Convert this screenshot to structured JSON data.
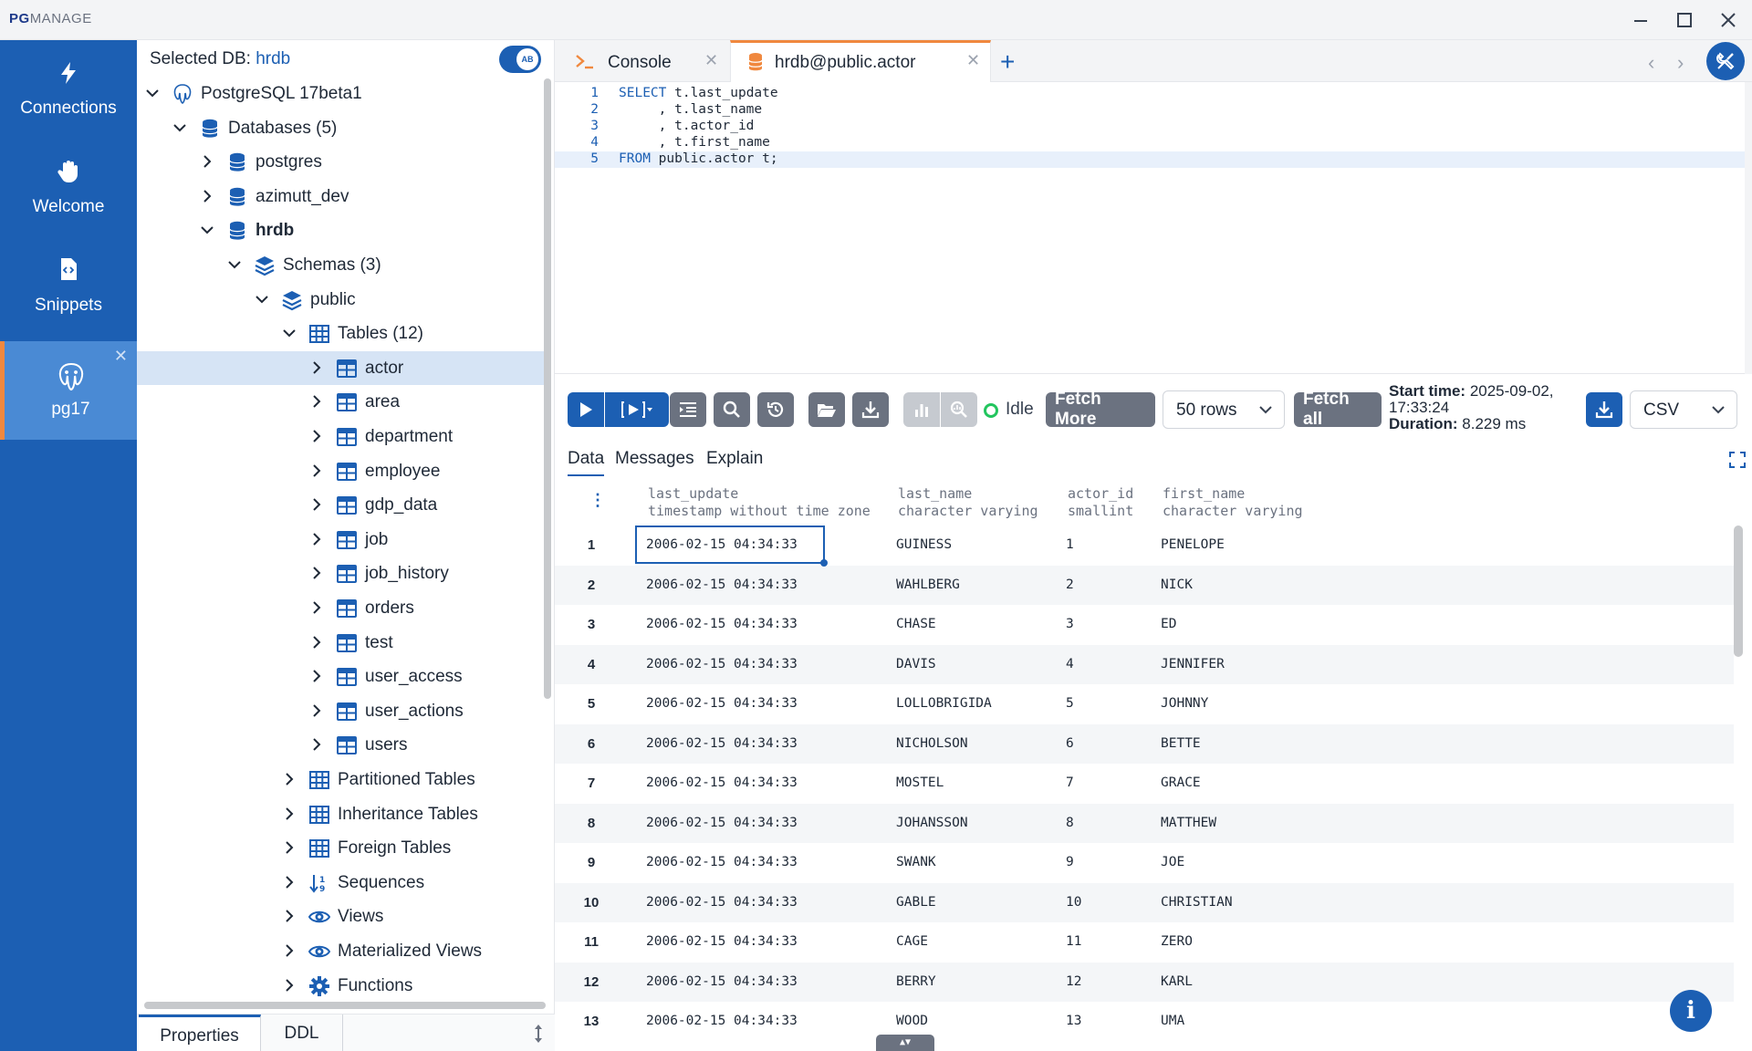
{
  "window": {
    "title_bold": "PG",
    "title_rest": "MANAGE"
  },
  "nav": {
    "items": [
      {
        "label": "Connections",
        "icon": "bolt-icon"
      },
      {
        "label": "Welcome",
        "icon": "hand-icon"
      },
      {
        "label": "Snippets",
        "icon": "code-file-icon"
      },
      {
        "label": "pg17",
        "icon": "postgres-elephant-icon",
        "close": "✕"
      }
    ]
  },
  "tree": {
    "selected_db_label": "Selected DB:",
    "selected_db_value": "hrdb",
    "nodes": [
      {
        "label": "PostgreSQL 17beta1",
        "depth": 0,
        "expanded": true,
        "icon": "elephant"
      },
      {
        "label": "Databases (5)",
        "depth": 1,
        "expanded": true,
        "icon": "database"
      },
      {
        "label": "postgres",
        "depth": 2,
        "expanded": false,
        "icon": "database"
      },
      {
        "label": "azimutt_dev",
        "depth": 2,
        "expanded": false,
        "icon": "database"
      },
      {
        "label": "hrdb",
        "depth": 2,
        "expanded": true,
        "icon": "database",
        "bold": true
      },
      {
        "label": "Schemas (3)",
        "depth": 3,
        "expanded": true,
        "icon": "layers"
      },
      {
        "label": "public",
        "depth": 4,
        "expanded": true,
        "icon": "layers"
      },
      {
        "label": "Tables (12)",
        "depth": 5,
        "expanded": true,
        "icon": "grid"
      },
      {
        "label": "actor",
        "depth": 6,
        "expanded": false,
        "icon": "table",
        "selected": true
      },
      {
        "label": "area",
        "depth": 6,
        "expanded": false,
        "icon": "table"
      },
      {
        "label": "department",
        "depth": 6,
        "expanded": false,
        "icon": "table"
      },
      {
        "label": "employee",
        "depth": 6,
        "expanded": false,
        "icon": "table"
      },
      {
        "label": "gdp_data",
        "depth": 6,
        "expanded": false,
        "icon": "table"
      },
      {
        "label": "job",
        "depth": 6,
        "expanded": false,
        "icon": "table"
      },
      {
        "label": "job_history",
        "depth": 6,
        "expanded": false,
        "icon": "table"
      },
      {
        "label": "orders",
        "depth": 6,
        "expanded": false,
        "icon": "table"
      },
      {
        "label": "test",
        "depth": 6,
        "expanded": false,
        "icon": "table"
      },
      {
        "label": "user_access",
        "depth": 6,
        "expanded": false,
        "icon": "table"
      },
      {
        "label": "user_actions",
        "depth": 6,
        "expanded": false,
        "icon": "table"
      },
      {
        "label": "users",
        "depth": 6,
        "expanded": false,
        "icon": "table"
      },
      {
        "label": "Partitioned Tables",
        "depth": 5,
        "expanded": false,
        "icon": "grid"
      },
      {
        "label": "Inheritance Tables",
        "depth": 5,
        "expanded": false,
        "icon": "grid"
      },
      {
        "label": "Foreign Tables",
        "depth": 5,
        "expanded": false,
        "icon": "grid"
      },
      {
        "label": "Sequences",
        "depth": 5,
        "expanded": false,
        "icon": "sort"
      },
      {
        "label": "Views",
        "depth": 5,
        "expanded": false,
        "icon": "eye"
      },
      {
        "label": "Materialized Views",
        "depth": 5,
        "expanded": false,
        "icon": "eye"
      },
      {
        "label": "Functions",
        "depth": 5,
        "expanded": false,
        "icon": "gear"
      }
    ],
    "bottom_tabs": [
      "Properties",
      "DDL"
    ]
  },
  "tabs": {
    "items": [
      {
        "label": "Console",
        "close": "✕",
        "icon": "terminal-icon"
      },
      {
        "label": "hrdb@public.actor",
        "close": "✕",
        "icon": "database-icon",
        "active": true
      }
    ],
    "add": "+",
    "prev": "‹",
    "next": "›"
  },
  "editor": {
    "lines": [
      {
        "num": "1",
        "kw": "SELECT",
        "code": " t.last_update"
      },
      {
        "num": "2",
        "kw": "",
        "code": "     , t.last_name"
      },
      {
        "num": "3",
        "kw": "",
        "code": "     , t.actor_id"
      },
      {
        "num": "4",
        "kw": "",
        "code": "     , t.first_name"
      },
      {
        "num": "5",
        "kw": "FROM",
        "code": " public.actor t;"
      }
    ]
  },
  "toolbar": {
    "status": "Idle",
    "fetch_more": "Fetch More",
    "rows_option": "50 rows",
    "fetch_all": "Fetch all",
    "start_label": "Start time:",
    "start_value": "2025-09-02, 17:33:24",
    "duration_label": "Duration:",
    "duration_value": "8.229 ms",
    "export_format": "CSV",
    "colors": {
      "accent": "#1c5fb3",
      "idle": "#22c55e",
      "tab_accent": "#f0883e"
    }
  },
  "results": {
    "tabs": [
      "Data",
      "Messages",
      "Explain"
    ],
    "columns": [
      {
        "name": "last_update",
        "type": "timestamp without time zone"
      },
      {
        "name": "last_name",
        "type": "character varying"
      },
      {
        "name": "actor_id",
        "type": "smallint"
      },
      {
        "name": "first_name",
        "type": "character varying"
      }
    ],
    "rows": [
      [
        "1",
        "2006-02-15 04:34:33",
        "GUINESS",
        "1",
        "PENELOPE"
      ],
      [
        "2",
        "2006-02-15 04:34:33",
        "WAHLBERG",
        "2",
        "NICK"
      ],
      [
        "3",
        "2006-02-15 04:34:33",
        "CHASE",
        "3",
        "ED"
      ],
      [
        "4",
        "2006-02-15 04:34:33",
        "DAVIS",
        "4",
        "JENNIFER"
      ],
      [
        "5",
        "2006-02-15 04:34:33",
        "LOLLOBRIGIDA",
        "5",
        "JOHNNY"
      ],
      [
        "6",
        "2006-02-15 04:34:33",
        "NICHOLSON",
        "6",
        "BETTE"
      ],
      [
        "7",
        "2006-02-15 04:34:33",
        "MOSTEL",
        "7",
        "GRACE"
      ],
      [
        "8",
        "2006-02-15 04:34:33",
        "JOHANSSON",
        "8",
        "MATTHEW"
      ],
      [
        "9",
        "2006-02-15 04:34:33",
        "SWANK",
        "9",
        "JOE"
      ],
      [
        "10",
        "2006-02-15 04:34:33",
        "GABLE",
        "10",
        "CHRISTIAN"
      ],
      [
        "11",
        "2006-02-15 04:34:33",
        "CAGE",
        "11",
        "ZERO"
      ],
      [
        "12",
        "2006-02-15 04:34:33",
        "BERRY",
        "12",
        "KARL"
      ],
      [
        "13",
        "2006-02-15 04:34:33",
        "WOOD",
        "13",
        "UMA"
      ]
    ]
  }
}
